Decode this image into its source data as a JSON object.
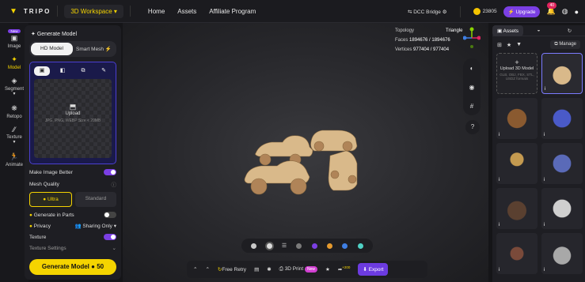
{
  "topbar": {
    "brand": "TRIPO",
    "workspace": "3D Workspace ▾",
    "nav": [
      "Home",
      "Assets",
      "Affiliate Program"
    ],
    "dcc_bridge": "DCC Bridge",
    "credits": "23805",
    "upgrade": "Upgrade",
    "notifications": "40"
  },
  "leftnav": [
    {
      "label": "Image",
      "icon": "image-icon",
      "tag": "New"
    },
    {
      "label": "Model",
      "icon": "sparkle-icon",
      "active": true
    },
    {
      "label": "Segment",
      "icon": "segment-icon"
    },
    {
      "label": "Retopo",
      "icon": "retopo-icon"
    },
    {
      "label": "Texture",
      "icon": "texture-icon"
    },
    {
      "label": "Animate",
      "icon": "animate-icon"
    }
  ],
  "panel": {
    "title": "Generate Model",
    "tabs": [
      "HD Model",
      "Smart Mesh"
    ],
    "upload_label": "Upload",
    "upload_hint": "JPG, PNG, WEBP Size < 20MB",
    "make_better": "Make Image Better",
    "mesh_quality": "Mesh Quality",
    "quality_options": [
      "Ultra",
      "Standard"
    ],
    "generate_in_parts": "Generate in Parts",
    "privacy": "Privacy",
    "sharing": "Sharing Only",
    "texture": "Texture",
    "texture_settings": "Texture Settings",
    "generate_button": "Generate Model",
    "generate_cost": "50"
  },
  "viewport": {
    "topology_label": "Topology",
    "topology_value": "Triangle",
    "faces_label": "Faces",
    "faces_value": "1894676 / 1894676",
    "vertices_label": "Vertices",
    "vertices_value": "977404 / 977404"
  },
  "colors": [
    "#c9c9c9",
    "#dcdcdc",
    "#7a7a7a",
    "#7b3fe4",
    "#e59a2e",
    "#3f7fe4",
    "#4fd1c5"
  ],
  "bottombar": {
    "free_retry": "Free Retry",
    "print_label": "3D Print",
    "print_tag": "New",
    "points": "+200",
    "export": "Export"
  },
  "rightpanel": {
    "tabs": [
      "Assets"
    ],
    "manage": "Manage",
    "upload_label": "Upload 3D Model",
    "upload_hint": "GLB, OBJ, FBX, STL, USDZ formats"
  }
}
